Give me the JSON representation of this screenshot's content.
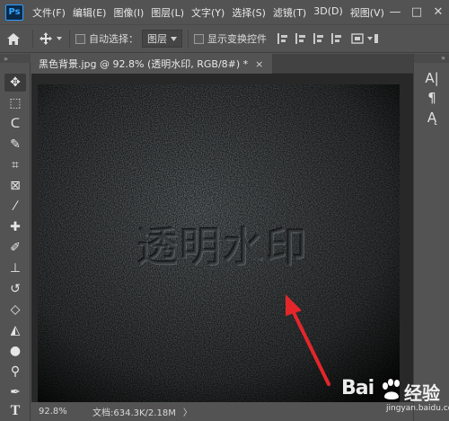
{
  "app": {
    "logo_text": "Ps"
  },
  "menu": [
    "文件(F)",
    "编辑(E)",
    "图像(I)",
    "图层(L)",
    "文字(Y)",
    "选择(S)",
    "滤镜(T)",
    "3D(D)",
    "视图(V)"
  ],
  "window_controls": {
    "minimize": "—",
    "maximize": "□",
    "close": "✕"
  },
  "options_bar": {
    "auto_select_label": "自动选择：",
    "auto_select_value": "图层",
    "show_transform_label": "显示变换控件"
  },
  "document": {
    "tab_title": "黑色背景.jpg @ 92.8% (透明水印, RGB/8#) *",
    "tab_close": "×",
    "watermark_text": "透明水印",
    "zoom": "92.8%",
    "doc_info": "文档:634.3K/2.18M",
    "status_arrow": "〉"
  },
  "right_panel": {
    "collapse": "»",
    "icons": [
      "character-icon",
      "paragraph-icon",
      "character-style-icon"
    ],
    "glyphs": [
      "A|",
      "¶",
      "Ą"
    ]
  },
  "toolbar": {
    "collapse": "»",
    "tools": [
      {
        "name": "move-tool-icon",
        "glyph": "✥"
      },
      {
        "name": "marquee-tool-icon",
        "glyph": "⬚"
      },
      {
        "name": "lasso-tool-icon",
        "glyph": "ᑕ"
      },
      {
        "name": "quick-select-tool-icon",
        "glyph": "✎"
      },
      {
        "name": "crop-tool-icon",
        "glyph": "⌗"
      },
      {
        "name": "frame-tool-icon",
        "glyph": "⊠"
      },
      {
        "name": "eyedropper-tool-icon",
        "glyph": "⁄"
      },
      {
        "name": "healing-brush-tool-icon",
        "glyph": "✚"
      },
      {
        "name": "brush-tool-icon",
        "glyph": "✐"
      },
      {
        "name": "stamp-tool-icon",
        "glyph": "⊥"
      },
      {
        "name": "history-brush-tool-icon",
        "glyph": "↺"
      },
      {
        "name": "eraser-tool-icon",
        "glyph": "◇"
      },
      {
        "name": "paint-bucket-tool-icon",
        "glyph": "◭"
      },
      {
        "name": "blur-tool-icon",
        "glyph": "●"
      },
      {
        "name": "dodge-tool-icon",
        "glyph": "⚲"
      },
      {
        "name": "pen-tool-icon",
        "glyph": "✒"
      },
      {
        "name": "type-tool-icon",
        "glyph": "T"
      }
    ]
  },
  "baidu_watermark": {
    "main": "Bai",
    "suffix": "经验",
    "url": "jingyan.baidu.com"
  }
}
